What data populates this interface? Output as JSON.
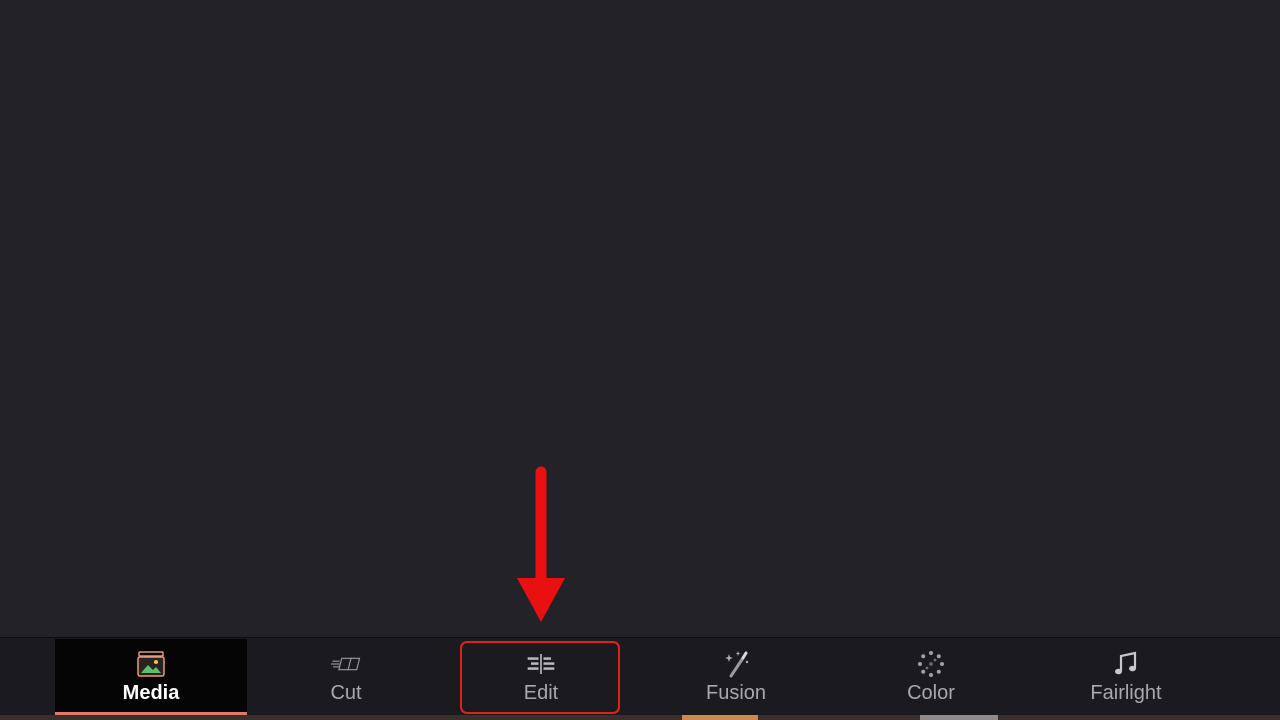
{
  "page_bar": {
    "tabs": [
      {
        "id": "media",
        "label": "Media",
        "icon": "media-icon",
        "active": true
      },
      {
        "id": "cut",
        "label": "Cut",
        "icon": "cut-icon",
        "active": false
      },
      {
        "id": "edit",
        "label": "Edit",
        "icon": "edit-icon",
        "active": false
      },
      {
        "id": "fusion",
        "label": "Fusion",
        "icon": "fusion-icon",
        "active": false
      },
      {
        "id": "color",
        "label": "Color",
        "icon": "color-icon",
        "active": false
      },
      {
        "id": "fairlight",
        "label": "Fairlight",
        "icon": "fairlight-icon",
        "active": false
      }
    ]
  },
  "annotation": {
    "target": "edit",
    "arrow_color": "#e81010",
    "box_color": "#e0221c"
  },
  "colors": {
    "background": "#232228",
    "page_bar": "#1b1b1f",
    "active_underline": "#e3766e",
    "label": "#a9a9ad"
  }
}
